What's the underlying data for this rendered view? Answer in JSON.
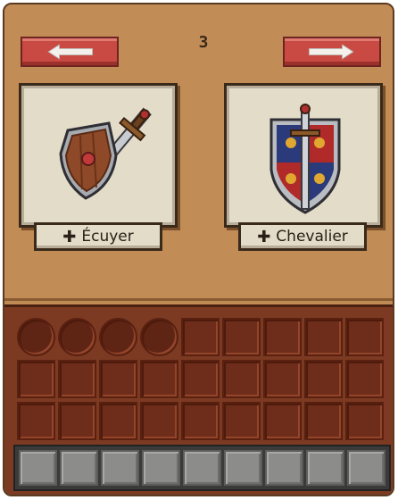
{
  "nav": {
    "page_number": "3",
    "prev_icon": "arrow-left-icon",
    "next_icon": "arrow-right-icon"
  },
  "cards": [
    {
      "label": "Écuyer",
      "icon": "shield-and-sword-icon"
    },
    {
      "label": "Chevalier",
      "icon": "heraldic-shield-sword-icon"
    }
  ],
  "inventory": {
    "rows": 3,
    "cols": 9,
    "filled_round_slots": 4,
    "hotbar_slots": 9
  },
  "colors": {
    "panel": "#c28c56",
    "button": "#c94a43",
    "inventory": "#7c3a22",
    "hotbar": "#8c8c8a"
  }
}
